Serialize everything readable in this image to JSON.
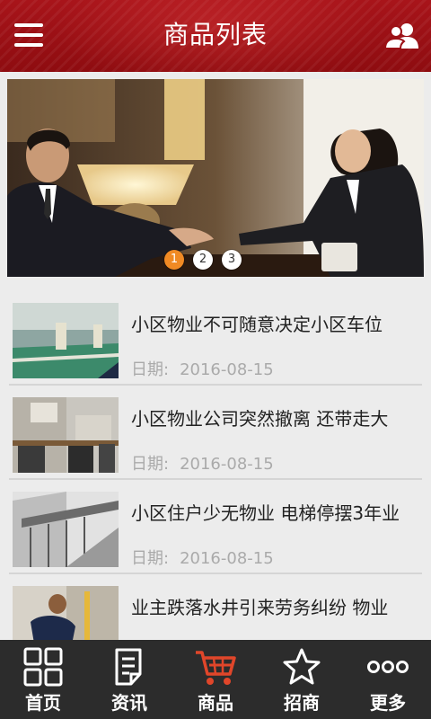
{
  "header": {
    "title": "商品列表",
    "menu_icon": "menu-icon",
    "user_icon": "users-icon"
  },
  "banner": {
    "slides": [
      "1",
      "2",
      "3"
    ],
    "active": 1
  },
  "list": {
    "items": [
      {
        "title": "小区物业不可随意决定小区车位",
        "date_label": "日期:",
        "date": "2016-08-15"
      },
      {
        "title": "小区物业公司突然撤离 还带走大",
        "date_label": "日期:",
        "date": "2016-08-15"
      },
      {
        "title": "小区住户少无物业 电梯停摆3年业",
        "date_label": "日期:",
        "date": "2016-08-15"
      },
      {
        "title": "业主跌落水井引来劳务纠纷 物业",
        "date_label": "",
        "date": ""
      }
    ]
  },
  "tabbar": {
    "tabs": [
      {
        "label": "首页",
        "icon": "grid-icon"
      },
      {
        "label": "资讯",
        "icon": "document-icon"
      },
      {
        "label": "商品",
        "icon": "cart-icon"
      },
      {
        "label": "招商",
        "icon": "star-icon"
      },
      {
        "label": "更多",
        "icon": "more-icon"
      }
    ],
    "active_index": 2,
    "accent": "#e0462a"
  },
  "colors": {
    "header": "#9c1015",
    "tabbar": "#2c2c2c",
    "dot_active": "#f08a24"
  }
}
